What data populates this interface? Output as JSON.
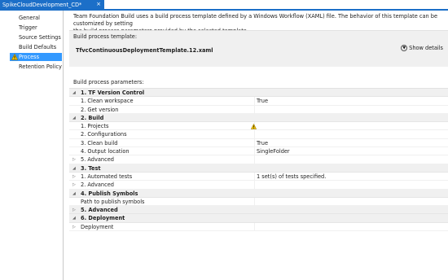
{
  "tab": {
    "title": "SpikeCloudDevelopment_CD*",
    "close_glyph": "×"
  },
  "sidebar": {
    "items": [
      {
        "label": "General",
        "active": false,
        "warning": false
      },
      {
        "label": "Trigger",
        "active": false,
        "warning": false
      },
      {
        "label": "Source Settings",
        "active": false,
        "warning": false
      },
      {
        "label": "Build Defaults",
        "active": false,
        "warning": false
      },
      {
        "label": "Process",
        "active": true,
        "warning": true
      },
      {
        "label": "Retention Policy",
        "active": false,
        "warning": false
      }
    ]
  },
  "main": {
    "description_line1": "Team Foundation Build uses a build process template defined by a Windows Workflow (XAML) file. The behavior of this template can be customized by setting",
    "description_line2": "the build process parameters provided by the selected template.",
    "template_label": "Build process template:",
    "template_name": "TfvcContinuousDeploymentTemplate.12.xaml",
    "show_details": "Show details",
    "params_label": "Build process parameters:"
  },
  "params": [
    {
      "type": "cat",
      "expander": "◢",
      "name": "1. TF Version Control",
      "value": ""
    },
    {
      "type": "child",
      "expander": "",
      "name": "1. Clean workspace",
      "value": "True"
    },
    {
      "type": "child",
      "expander": "",
      "name": "2. Get version",
      "value": ""
    },
    {
      "type": "cat",
      "expander": "◢",
      "name": "2. Build",
      "value": ""
    },
    {
      "type": "child",
      "expander": "",
      "name": "1. Projects",
      "value": "",
      "warning": true
    },
    {
      "type": "child",
      "expander": "",
      "name": "2. Configurations",
      "value": ""
    },
    {
      "type": "child",
      "expander": "",
      "name": "3. Clean build",
      "value": "True"
    },
    {
      "type": "child",
      "expander": "",
      "name": "4. Output location",
      "value": "SingleFolder"
    },
    {
      "type": "child",
      "expander": "▷",
      "name": "5. Advanced",
      "value": ""
    },
    {
      "type": "cat",
      "expander": "◢",
      "name": "3. Test",
      "value": ""
    },
    {
      "type": "child",
      "expander": "▷",
      "name": "1. Automated tests",
      "value": "1 set(s) of tests specified."
    },
    {
      "type": "child",
      "expander": "▷",
      "name": "2. Advanced",
      "value": ""
    },
    {
      "type": "cat",
      "expander": "◢",
      "name": "4. Publish Symbols",
      "value": ""
    },
    {
      "type": "child",
      "expander": "",
      "name": "Path to publish symbols",
      "value": ""
    },
    {
      "type": "cat",
      "expander": "▷",
      "name": "5. Advanced",
      "value": ""
    },
    {
      "type": "cat",
      "expander": "◢",
      "name": "6. Deployment",
      "value": ""
    },
    {
      "type": "child",
      "expander": "▷",
      "name": "Deployment",
      "value": ""
    }
  ],
  "colors": {
    "accent": "#1c6fc8",
    "selection": "#3399ff",
    "category_bg": "#f0f0f0",
    "warning": "#f2c200"
  }
}
